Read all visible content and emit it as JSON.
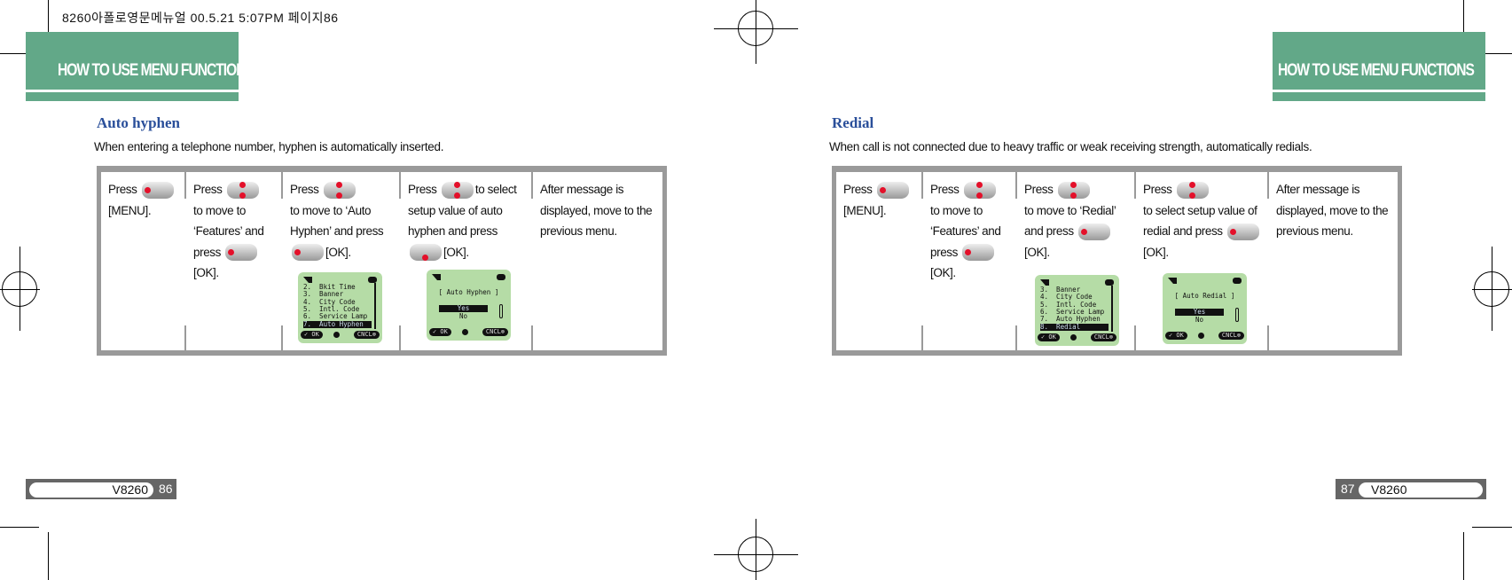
{
  "print_header": "8260아폴로영문메뉴얼   00.5.21 5:07PM 페이지86",
  "section_header": "HOW TO USE MENU FUNCTIONS",
  "left": {
    "title": "Auto hyphen",
    "description": "When entering a telephone number, hyphen is automatically inserted.",
    "steps": [
      [
        [
          {
            "t": "Press "
          },
          {
            "k": "left"
          }
        ],
        [
          {
            "t": "[MENU]."
          }
        ]
      ],
      [
        [
          {
            "t": "Press "
          },
          {
            "k": "updown"
          }
        ],
        [
          {
            "t": "to move to"
          }
        ],
        [
          {
            "t": "  ‘Features’ and"
          }
        ],
        [
          {
            "t": "press "
          },
          {
            "k": "left"
          }
        ],
        [
          {
            "t": "[OK]."
          }
        ]
      ],
      [
        [
          {
            "t": "Press "
          },
          {
            "k": "updown"
          }
        ],
        [
          {
            "t": "to move to ‘Auto"
          }
        ],
        [
          {
            "t": "Hyphen’ and press"
          }
        ],
        [
          {
            "k": "left"
          },
          {
            "t": "[OK]."
          }
        ]
      ],
      [
        [
          {
            "t": "Press "
          },
          {
            "k": "updown"
          },
          {
            "t": "to select"
          }
        ],
        [
          {
            "t": "setup value of auto"
          }
        ],
        [
          {
            "t": "hyphen and press"
          }
        ],
        [
          {
            "k": "down"
          },
          {
            "t": "[OK]."
          }
        ]
      ],
      [
        [
          {
            "t": "After message is"
          }
        ],
        [
          {
            "t": "displayed, move to the"
          }
        ],
        [
          {
            "t": "previous menu."
          }
        ]
      ]
    ],
    "screens": [
      {
        "type": "list",
        "lines": [
          "2.  Bkit Time",
          "3.  Banner",
          "4.  City Code",
          "5.  Intl. Code",
          "6.  Service Lamp",
          "7.  Auto Hyphen"
        ],
        "selected": 5,
        "ok": "OK",
        "cancel": "CNCL"
      },
      {
        "type": "dialog",
        "heading": "[ Auto Hyphen ]",
        "options": [
          "Yes",
          "No"
        ],
        "selected": 0,
        "ok": "OK",
        "cancel": "CNCL"
      }
    ],
    "model": "V8260",
    "page": "86"
  },
  "right": {
    "title": "Redial",
    "description": "When  call  is  not  connected  due  to  heavy  traffic  or  weak   receiving strength, automatically redials.",
    "steps": [
      [
        [
          {
            "t": "Press "
          },
          {
            "k": "left"
          }
        ],
        [
          {
            "t": "[MENU]."
          }
        ]
      ],
      [
        [
          {
            "t": "Press "
          },
          {
            "k": "updown"
          }
        ],
        [
          {
            "t": "to move to"
          }
        ],
        [
          {
            "t": "  ‘Features’ and"
          }
        ],
        [
          {
            "t": "press "
          },
          {
            "k": "left"
          }
        ],
        [
          {
            "t": "[OK]."
          }
        ]
      ],
      [
        [
          {
            "t": "Press "
          },
          {
            "k": "updown"
          }
        ],
        [
          {
            "t": "to move to ‘Redial’"
          }
        ],
        [
          {
            "t": "and press "
          },
          {
            "k": "left"
          }
        ],
        [
          {
            "t": "[OK]."
          }
        ]
      ],
      [
        [
          {
            "t": "Press "
          },
          {
            "k": "updown"
          }
        ],
        [
          {
            "t": "to select setup value of"
          }
        ],
        [
          {
            "t": "redial and press "
          },
          {
            "k": "left"
          }
        ],
        [
          {
            "t": "[OK]."
          }
        ]
      ],
      [
        [
          {
            "t": "After message is"
          }
        ],
        [
          {
            "t": "displayed, move to the"
          }
        ],
        [
          {
            "t": "previous menu."
          }
        ]
      ]
    ],
    "screens": [
      {
        "type": "list",
        "lines": [
          "3.  Banner",
          "4.  City Code",
          "5.  Intl. Code",
          "6.  Service Lamp",
          "7.  Auto Hyphen",
          "8.  Redial"
        ],
        "selected": 5,
        "ok": "OK",
        "cancel": "CNCL"
      },
      {
        "type": "dialog",
        "heading": "[ Auto Redial ]",
        "options": [
          "Yes",
          "No"
        ],
        "selected": 0,
        "ok": "OK",
        "cancel": "CNCL"
      }
    ],
    "model": "V8260",
    "page": "87"
  },
  "colors": {
    "header_green": "#62a888",
    "title_blue": "#2a4f9a",
    "key_red": "#e4102a",
    "screen_green": "#b5dca6"
  }
}
